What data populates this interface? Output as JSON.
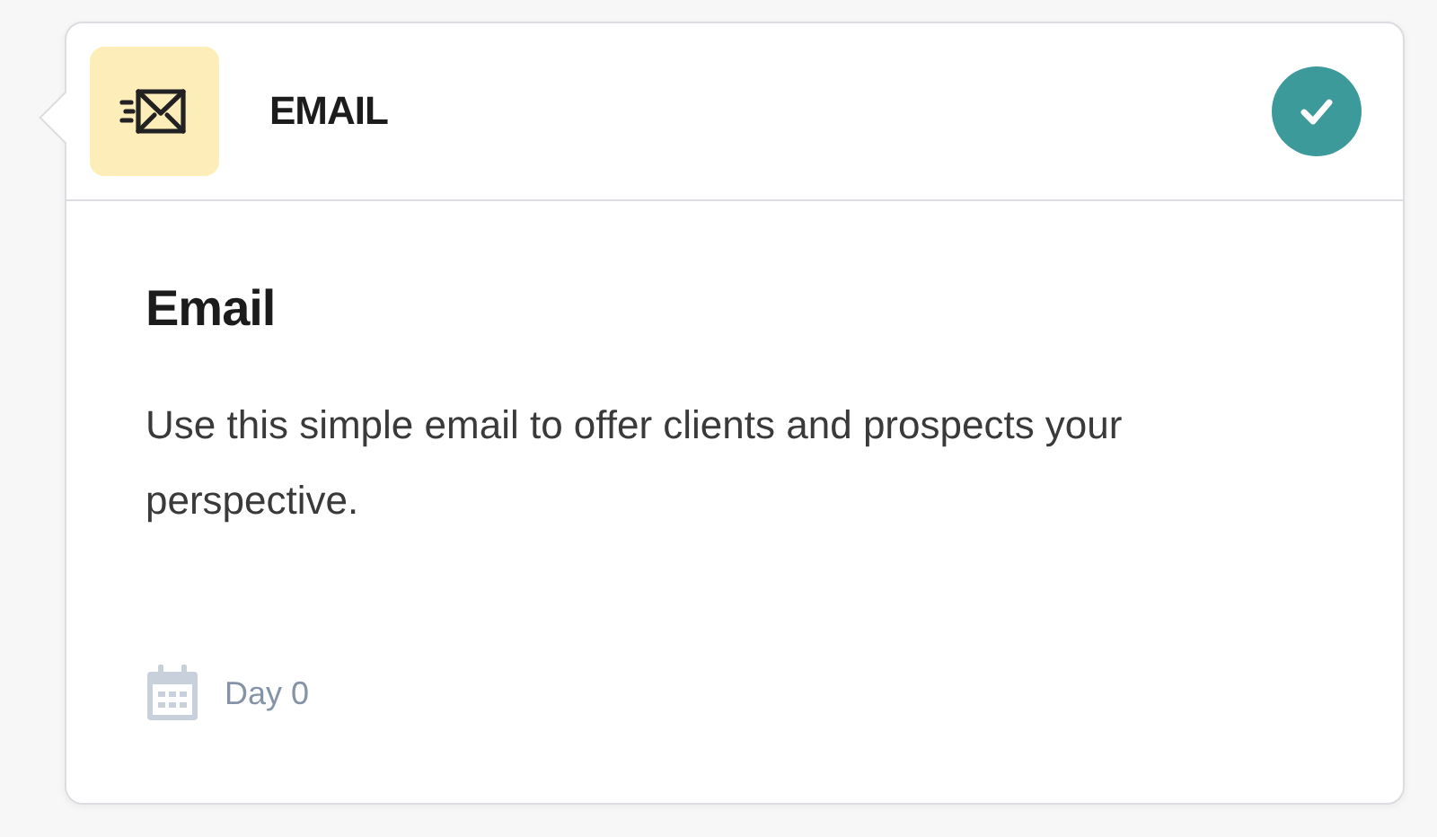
{
  "step": {
    "type_label": "EMAIL",
    "completed": true
  },
  "title": "Email",
  "description": "Use this simple email to offer clients and prospects your perspective.",
  "schedule": {
    "label": "Day 0"
  }
}
